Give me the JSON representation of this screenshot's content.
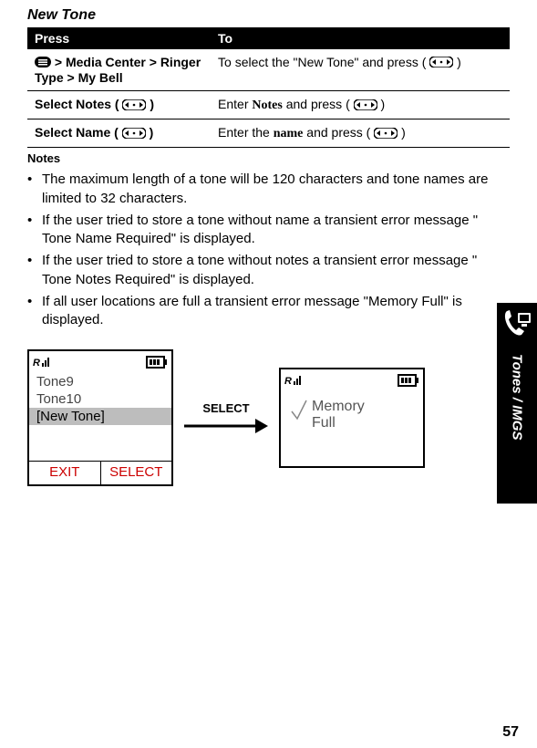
{
  "section_title": "New Tone",
  "table": {
    "head_press": "Press",
    "head_to": "To",
    "rows": [
      {
        "press_prefix_icon": "menu-key-icon",
        "press": " > Media Center > Ringer Type > My Bell",
        "to_pre": "To select the \"New Tone\" and press  ( ",
        "to_key_icon": "nav-key-icon",
        "to_post": " )"
      },
      {
        "press_label": "Select Notes ( ",
        "press_key_icon": "nav-key-icon",
        "press_close": " )",
        "to_pre": "Enter ",
        "to_serif": "Notes",
        "to_mid": " and press ( ",
        "to_key_icon": "nav-key-icon",
        "to_post": " )"
      },
      {
        "press_label": "Select Name ( ",
        "press_key_icon": "nav-key-icon",
        "press_close": " )",
        "to_pre": "Enter the ",
        "to_serif": "name",
        "to_mid": " and press (",
        "to_key_icon": "nav-key-icon",
        "to_post": ")"
      }
    ]
  },
  "notes_header": "Notes",
  "notes": [
    "The maximum length of a tone will be 120 characters and tone names are limited to 32 characters.",
    "If the user tried to store a tone without name a transient error message \" Tone Name Required\" is displayed.",
    "If the user tried to store a tone without notes a transient error message \" Tone Notes Required\" is displayed.",
    "If all user locations are full a transient error message \"Memory Full\" is displayed."
  ],
  "side_tab_label": "Tones / IMGS",
  "phone1": {
    "line1": "Tone9",
    "line2": "Tone10",
    "line3": "[New Tone]",
    "sk_left": "EXIT",
    "sk_right": "SELECT"
  },
  "arrow_label": "SELECT",
  "phone2": {
    "line1": "Memory",
    "line2": "Full"
  },
  "page_number": "57"
}
